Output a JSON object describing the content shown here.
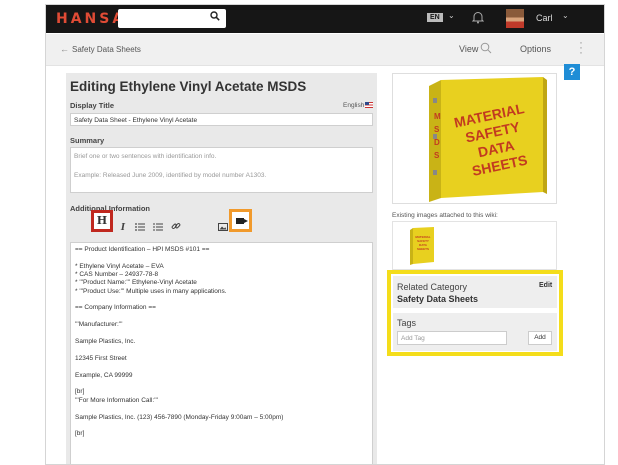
{
  "topbar": {
    "logo": "HANSAW",
    "search_placeholder": "",
    "language_badge": "EN",
    "user_name": "Carl",
    "icons": [
      "search-icon",
      "chevron-down-icon",
      "bell-icon",
      "avatar",
      "chevron-down-icon"
    ]
  },
  "breadcrumb": {
    "label": "Safety Data Sheets",
    "view_label": "View",
    "options_label": "Options"
  },
  "help": {
    "label": "?"
  },
  "editor": {
    "heading": "Editing Ethylene Vinyl Acetate MSDS",
    "display_title_label": "Display Title",
    "language": "English",
    "display_title_value": "Safety Data Sheet - Ethylene Vinyl Acetate",
    "summary_label": "Summary",
    "summary_placeholder_1": "Brief one or two sentences with identification info.",
    "summary_placeholder_2": "Example: Released June 2009, identified by model number A1303.",
    "additional_label": "Additional Information",
    "toolbar": {
      "heading": "H",
      "bold": "B",
      "italic": "I",
      "help": "?"
    },
    "content_lines": [
      "== Product Identification – HPI MSDS #101 ==",
      "",
      "* Ethylene Vinyl Acetate – EVA",
      "* CAS Number – 24937-78-8",
      "* '''Product Name:''' Ethylene-Vinyl Acetate",
      "* '''Product Use:''' Multiple uses in many applications.",
      "",
      "== Company Information ==",
      "",
      "'''Manufacturer:'''",
      "",
      "Sample Plastics, Inc.",
      "",
      "12345 First Street",
      "",
      "Example, CA 99999",
      "",
      "[br]",
      "'''For More Information Call:'''",
      "",
      "Sample Plastics, Inc. (123) 456-7890 (Monday-Friday 9:00am – 5:00pm)",
      "",
      "[br]"
    ]
  },
  "sidebar": {
    "binder_text": [
      "MATERIAL",
      "SAFETY",
      "DATA",
      "SHEETS"
    ],
    "binder_spine": [
      "M",
      "S",
      "D",
      "S"
    ],
    "thumb_text": [
      "MATERIAL",
      "SAFETY",
      "DATA",
      "SHEETS"
    ],
    "existing_images_label": "Existing images attached to this wiki:",
    "related_category_label": "Related Category",
    "related_category_value": "Safety Data Sheets",
    "edit_label": "Edit",
    "tags_label": "Tags",
    "add_tag_placeholder": "Add Tag",
    "add_button": "Add"
  },
  "colors": {
    "logo": "#e04b35",
    "highlight_red": "#c0281f",
    "highlight_orange": "#f19a2c",
    "highlight_yellow": "#f4dd1a",
    "help_blue": "#1f8dd6"
  }
}
